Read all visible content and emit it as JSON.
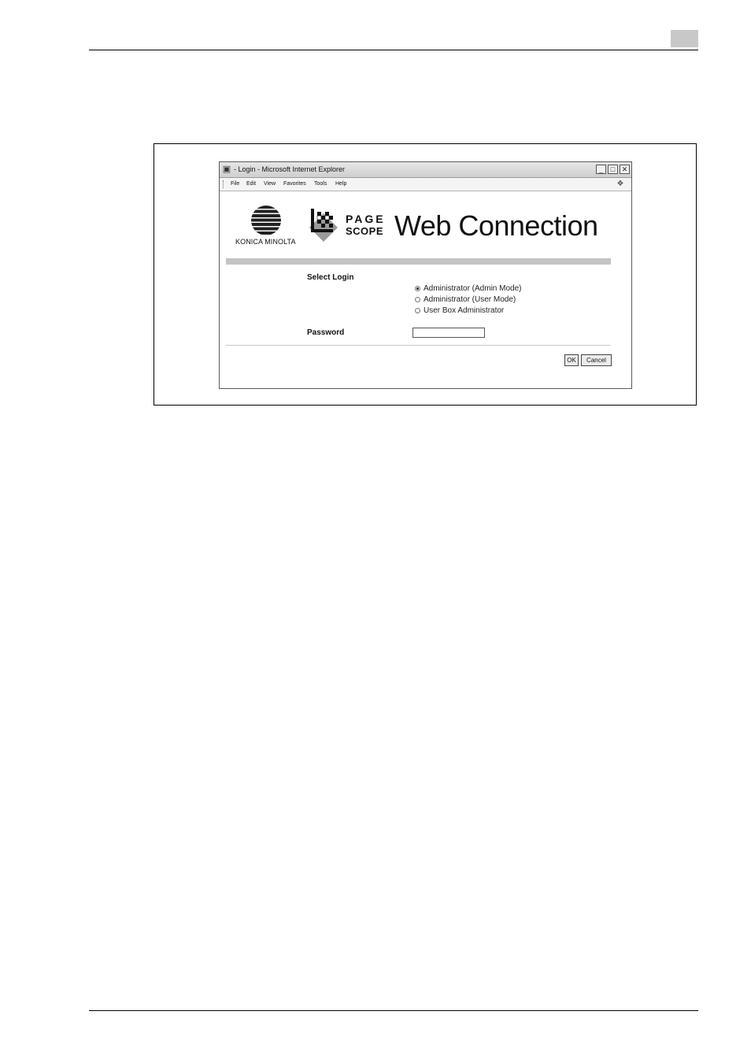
{
  "window": {
    "title": "- Login - Microsoft Internet Explorer",
    "controls": {
      "minimize": "_",
      "maximize": "□",
      "close": "✕"
    },
    "icons": {
      "page": "ie-page-icon",
      "flag": "windows-flag-icon"
    }
  },
  "menu": {
    "items": [
      "File",
      "Edit",
      "View",
      "Favorites",
      "Tools",
      "Help"
    ]
  },
  "header": {
    "brand": "KONICA MINOLTA",
    "product_line1": "PAGE",
    "product_line2": "SCOPE",
    "product_title": "Web Connection"
  },
  "form": {
    "select_label": "Select Login",
    "options": [
      {
        "label": "Administrator (Admin Mode)",
        "selected": true
      },
      {
        "label": "Administrator (User Mode)",
        "selected": false
      },
      {
        "label": "User Box Administrator",
        "selected": false
      }
    ],
    "password_label": "Password",
    "password_value": ""
  },
  "buttons": {
    "ok": "OK",
    "cancel": "Cancel"
  }
}
